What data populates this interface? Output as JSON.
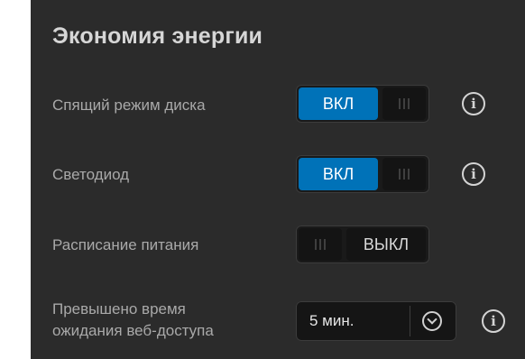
{
  "section": {
    "title": "Экономия энергии"
  },
  "settings": {
    "disk_sleep": {
      "label": "Спящий режим диска",
      "state_label": "ВКЛ",
      "state": "on"
    },
    "led": {
      "label": "Светодиод",
      "state_label": "ВКЛ",
      "state": "on"
    },
    "power_schedule": {
      "label": "Расписание питания",
      "state_label": "ВЫКЛ",
      "state": "off"
    },
    "web_timeout": {
      "label_line1": "Превышено время",
      "label_line2": "ожидания веб-доступа",
      "selected": "5 мин."
    }
  },
  "colors": {
    "panel_bg": "#2b2b2b",
    "accent_on": "#0072b8",
    "title_text": "#d6d6d6",
    "label_text": "#a9a9a9"
  },
  "icons": {
    "info": "info-circle-icon",
    "dropdown": "chevron-down-circle-icon",
    "grip": "grip-lines-icon"
  }
}
